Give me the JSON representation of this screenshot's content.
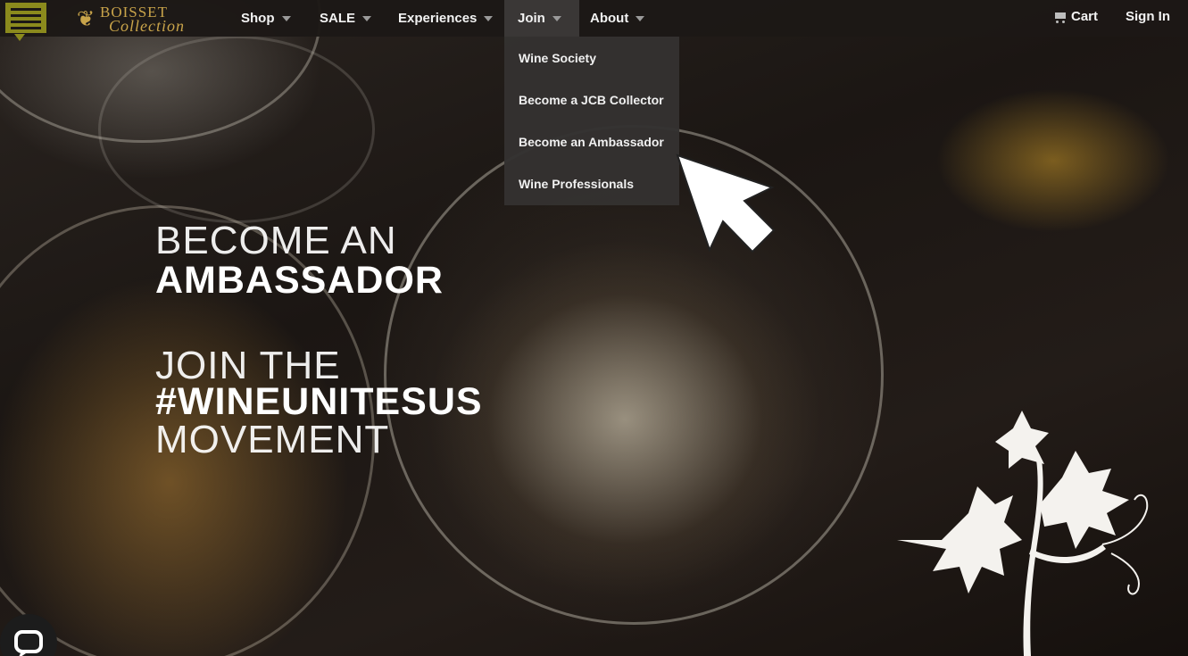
{
  "brand": {
    "logo_line1": "BOISSET",
    "logo_line2": "Collection",
    "accent_color": "#8b8a1d",
    "logo_color": "#c9a44a"
  },
  "nav": {
    "items": [
      {
        "label": "Shop",
        "has_caret": true
      },
      {
        "label": "SALE",
        "has_caret": true
      },
      {
        "label": "Experiences",
        "has_caret": true
      },
      {
        "label": "Join",
        "has_caret": true,
        "active": true
      },
      {
        "label": "About",
        "has_caret": true
      }
    ],
    "cart_label": "Cart",
    "cart_icon": "shopping-cart-icon",
    "signin_label": "Sign In",
    "menu_icon": "hamburger-menu-icon"
  },
  "join_dropdown": {
    "items": [
      {
        "label": "Wine Society"
      },
      {
        "label": "Become a JCB Collector"
      },
      {
        "label": "Become an Ambassador"
      },
      {
        "label": "Wine Professionals"
      }
    ]
  },
  "hero": {
    "line1": "BECOME AN",
    "line2": "AMBASSADOR",
    "line3": "JOIN THE",
    "line4": "#WINEUNITESUS",
    "line5": "MOVEMENT"
  },
  "widgets": {
    "chat_icon": "chat-bubble-icon",
    "pointer_icon": "cursor-arrow-icon",
    "vine_icon": "grapevine-illustration"
  }
}
